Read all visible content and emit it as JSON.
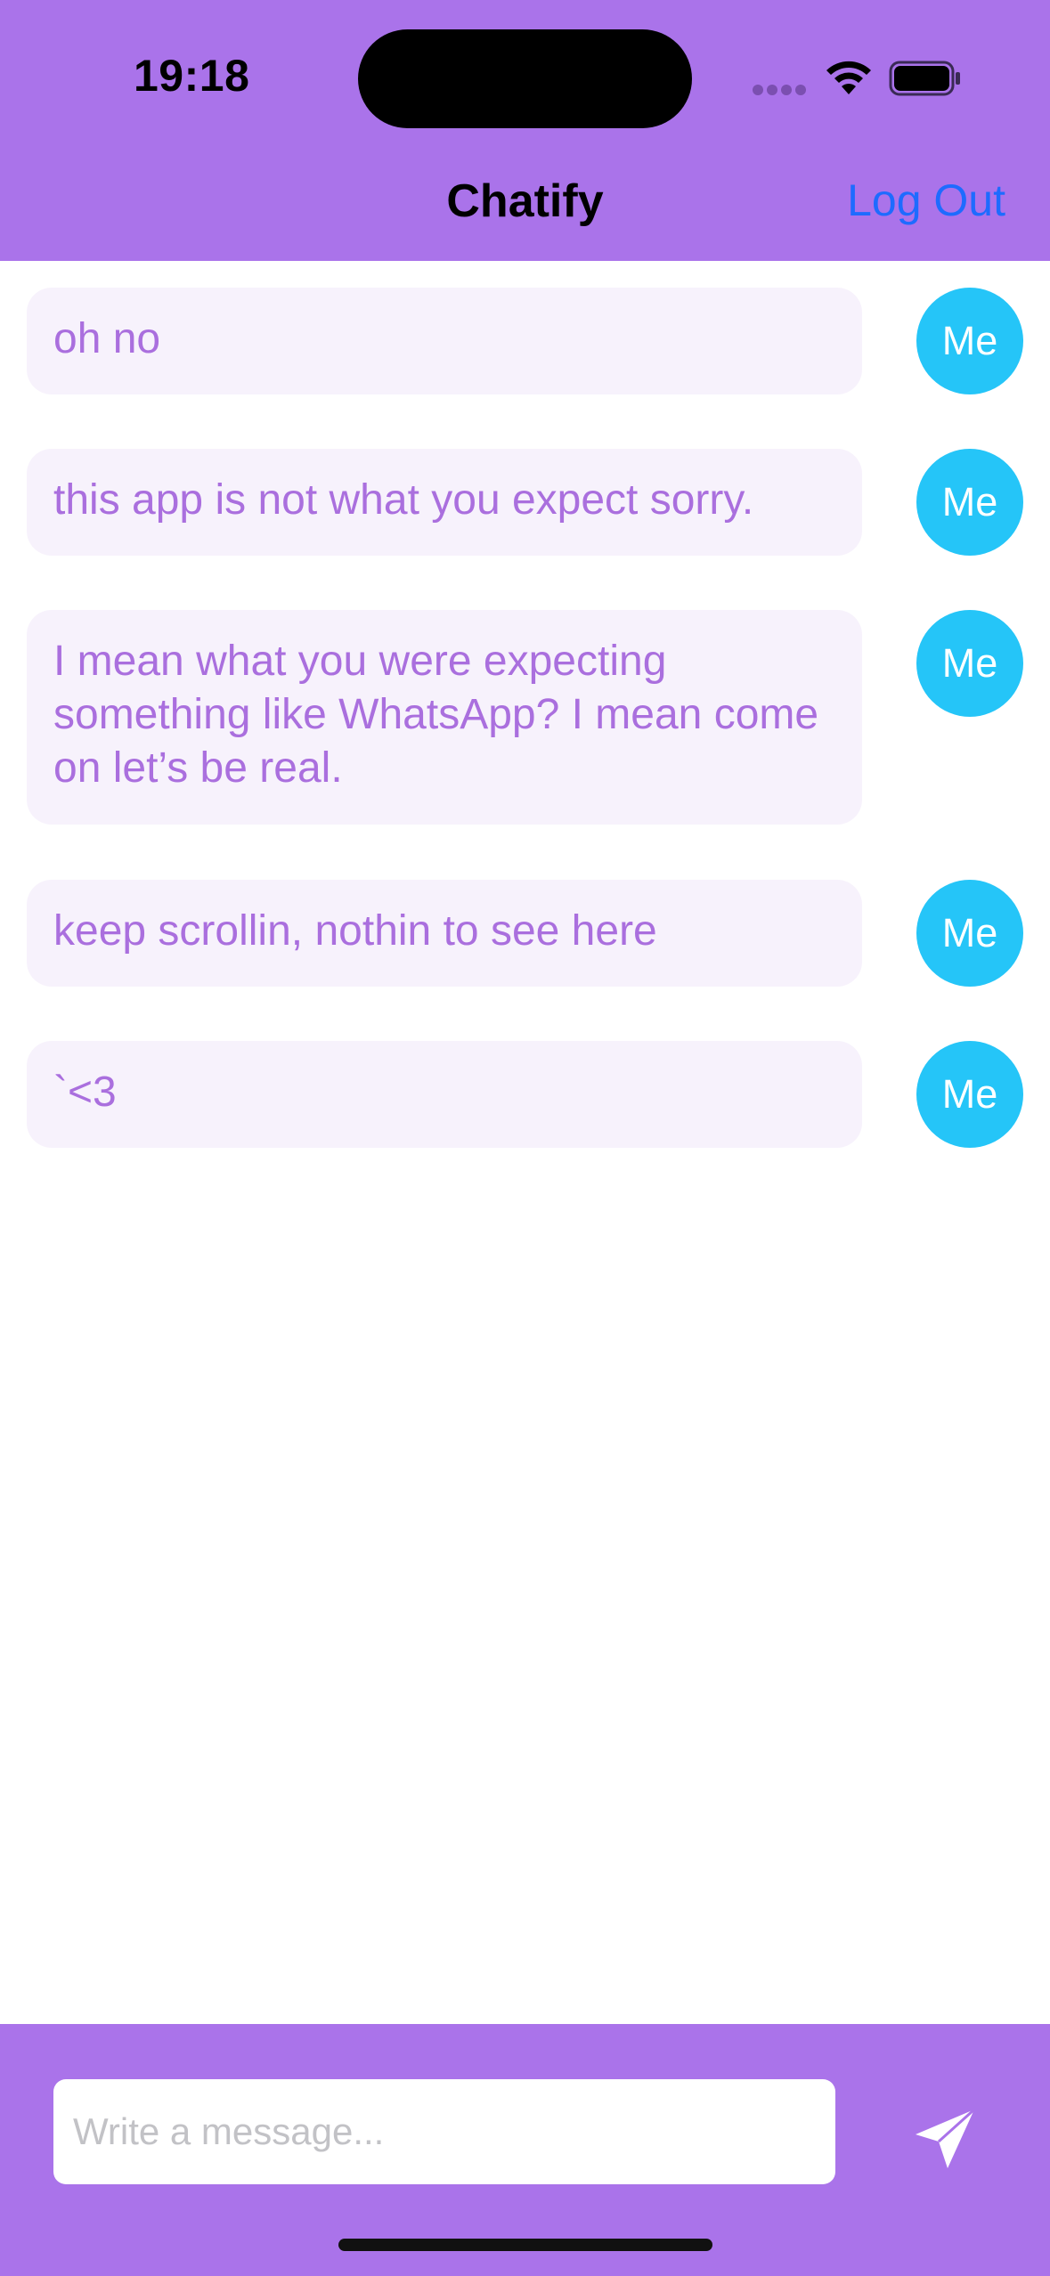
{
  "status_bar": {
    "time": "19:18"
  },
  "header": {
    "title": "Chatify",
    "logout_label": "Log Out"
  },
  "messages": [
    {
      "text": "oh no",
      "avatar": "Me"
    },
    {
      "text": "this app is not what you expect sorry.",
      "avatar": "Me"
    },
    {
      "text": "I mean what you were expecting something like WhatsApp? I mean come on let’s be real.",
      "avatar": "Me"
    },
    {
      "text": "keep scrollin, nothin to see here",
      "avatar": "Me"
    },
    {
      "text": "`<3",
      "avatar": "Me"
    }
  ],
  "composer": {
    "placeholder": "Write a message...",
    "value": "",
    "send_icon": "paper-plane-icon"
  },
  "colors": {
    "brand": "#AA73EA",
    "bubble_bg": "#F7F2FC",
    "bubble_text": "#AA6FDE",
    "avatar_bg": "#25C5F8",
    "link": "#1E6BFF"
  }
}
